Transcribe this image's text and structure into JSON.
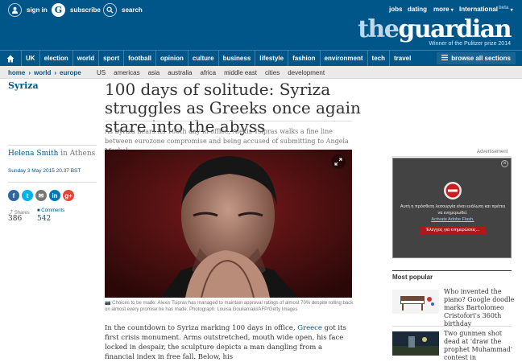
{
  "topbar": {
    "signin": "sign in",
    "subscribe": "subscribe",
    "search": "search",
    "jobs": "jobs",
    "dating": "dating",
    "more": "more",
    "international": "International",
    "beta": "beta",
    "logo_the": "the",
    "logo_guardian": "guardian",
    "award": "Winner of the Pulitzer prize 2014"
  },
  "nav": {
    "items": [
      "UK",
      "election",
      "world",
      "sport",
      "football",
      "opinion",
      "culture",
      "business",
      "lifestyle",
      "fashion",
      "environment",
      "tech",
      "travel"
    ],
    "browse_all": "browse all sections"
  },
  "breadcrumb": [
    "home",
    "world",
    "europe"
  ],
  "subnav": [
    "US",
    "americas",
    "asia",
    "australia",
    "africa",
    "middle east",
    "cities",
    "development"
  ],
  "article": {
    "section": "Syriza",
    "headline": "100 days of solitude: Syriza struggles as Greeks once again stare into the abyss",
    "standfirst": "As Syriza nears its 100th day in office, Alexis Tsipras walks a fine line between eurozone compromise and being accused of submitting to Angela Merkel",
    "author": "Helena Smith",
    "location": " in Athens",
    "date": "Sunday 3 May 2015 20.37 BST",
    "shares_label": "Shares",
    "shares_count": "386",
    "comments_label": "Comments",
    "comments_count": "542",
    "caption": "Choices to be made: Alexis Tsipras has managed to maintain approval ratings of almost 70% despite rolling back on almost every promise he has made. Photograph: Louisa Gouliamaki/AFP/Getty Images",
    "body_pre": "In the countdown to Syriza marking 100 days in office, ",
    "body_link": "Greece",
    "body_post": " got its first crisis monument. Arms outstretched, mouth wide open, his face locked in despair, the sculpture depicts a man dangling from a financial index in free fall. Below, his"
  },
  "social": {
    "facebook": "f",
    "twitter": "t",
    "email": "✉",
    "linkedin": "in",
    "googleplus": "g+"
  },
  "ad": {
    "label": "Advertisement",
    "text": "Αυτή η πρόσθετη λειτουργία είναι ευάλωτη και πρέπει να ενημερωθεί.",
    "link": "Activate Adobe Flash.",
    "button": "Έλεγχος για ενημερώσεις..."
  },
  "most_popular": {
    "title": "Most popular",
    "items": [
      {
        "text": "Who invented the piano? Google doodle marks Bartolomeo Cristofori's 360th birthday"
      },
      {
        "text": "Two gunmen shot dead at 'draw the prophet Muhammad' contest in"
      }
    ]
  }
}
